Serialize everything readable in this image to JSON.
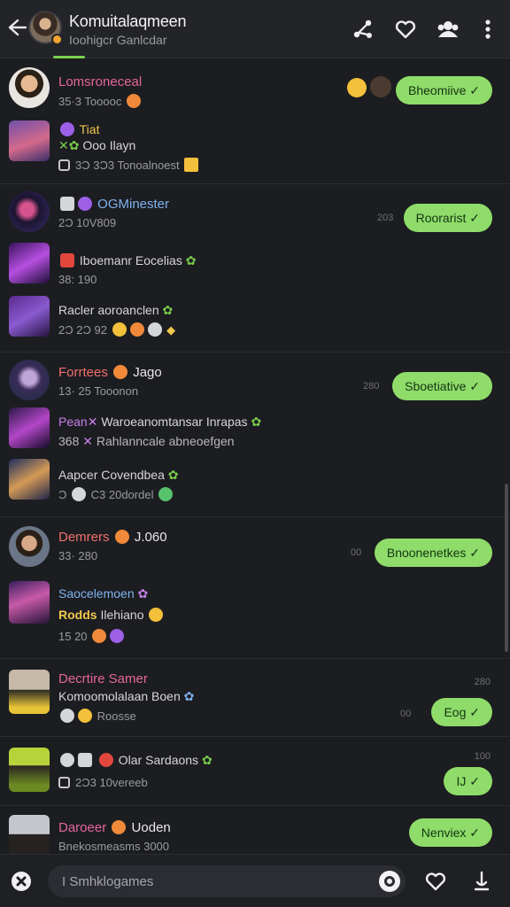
{
  "header": {
    "title": "Komuitalaqmeen",
    "subtitle": "Ioohigcr Ganlcdar"
  },
  "chats": [
    {
      "name": "Lomsroneceal",
      "meta": "35·3  Tooooc",
      "line2": "Tiat",
      "line3": "Ooo Ilayn",
      "line4": "3Ɔ 3Ɔ3  Tonoalnoest",
      "bubble": "Bheomiive ✓"
    },
    {
      "name": "OGMinester",
      "meta": "2Ɔ  10V809",
      "line2": "Iboemanr Eocelias",
      "line3": "38: 190",
      "line4": "Racler aoroanclen",
      "line5": "2Ɔ  2Ɔ  92",
      "time": "203",
      "bubble": "Roorarist ✓"
    },
    {
      "name": "Forrtees",
      "name_suffix": "Jago",
      "meta": "13·  25  Tooonon",
      "line2": "Waroeanomtansar Inrapas",
      "line2_prefix": "Pean",
      "line3": "Rahlanncale abneoefgen",
      "line3_prefix": "368",
      "line4": "Aapcer Covendbea",
      "line5": "C3  20dordel",
      "time": "280",
      "bubble": "Sboetiative ✓"
    },
    {
      "name": "Demrers",
      "name_suffix": "J.060",
      "meta": "33· 280",
      "line2": "Saocelemoen",
      "line3": "Rodds",
      "line3_suffix": "Ilehiano",
      "line4": "15  20",
      "time": "00",
      "bubble": "Bnoonenetkes ✓"
    },
    {
      "name": "Decrtire Samer",
      "line2": "Komoomolalaan Boen",
      "meta": "Roosse",
      "time_top": "280",
      "time": "00",
      "bubble": "Eog ✓"
    },
    {
      "name": "Olar Sardaons",
      "meta": "2Ɔ3  10vereeb",
      "time_top": "100",
      "bubble": "IJ ✓"
    },
    {
      "name": "Daroeer",
      "name_suffix": "Uoden",
      "meta": "Bnekosmeasms 3000",
      "bubble": "Nenviex ✓"
    }
  ],
  "bottom": {
    "search_placeholder": "I Smhklogames"
  },
  "icons": [
    "back-arrow-icon",
    "share-icon",
    "heart-icon",
    "group-icon",
    "more-vertical-icon",
    "compass-icon",
    "camera-icon",
    "heart-outline-icon",
    "pin-icon"
  ],
  "colors": {
    "background": "#1c1d21",
    "bubble": "#8fdc6a",
    "accent_green": "#7bd14f",
    "name_pink": "#e3669a"
  }
}
